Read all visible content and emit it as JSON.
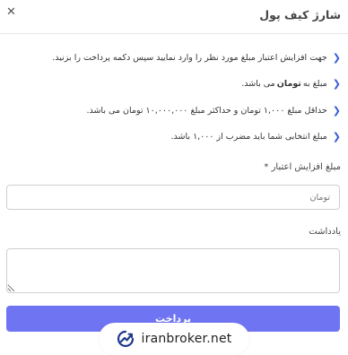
{
  "dialog": {
    "title": "شارژ کیف پول",
    "close_icon": "close-icon"
  },
  "rules": [
    {
      "text": "جهت افزایش اعتبار مبلغ مورد نظر را وارد نمایید سپس دکمه پرداخت را بزنید."
    },
    {
      "before": "مبلغ به",
      "bold": "تومان",
      "after": "می باشد."
    },
    {
      "text": "حداقل مبلغ ۱,۰۰۰ تومان و حداکثر مبلغ ۱۰,۰۰۰,۰۰۰ تومان می باشد."
    },
    {
      "text": "مبلغ انتخابی شما باید مضرب از ۱,۰۰۰ باشد."
    }
  ],
  "form": {
    "amount_label": "مبلغ افزایش اعتبار *",
    "amount_placeholder": "تومان",
    "amount_value": "",
    "note_label": "یادداشت",
    "note_value": ""
  },
  "pay_button": "پرداخت",
  "watermark": {
    "text": "iranbroker.net",
    "icon": "trend-chart-icon"
  },
  "colors": {
    "accent": "#3b5bdb",
    "button": "#6f74f2"
  }
}
